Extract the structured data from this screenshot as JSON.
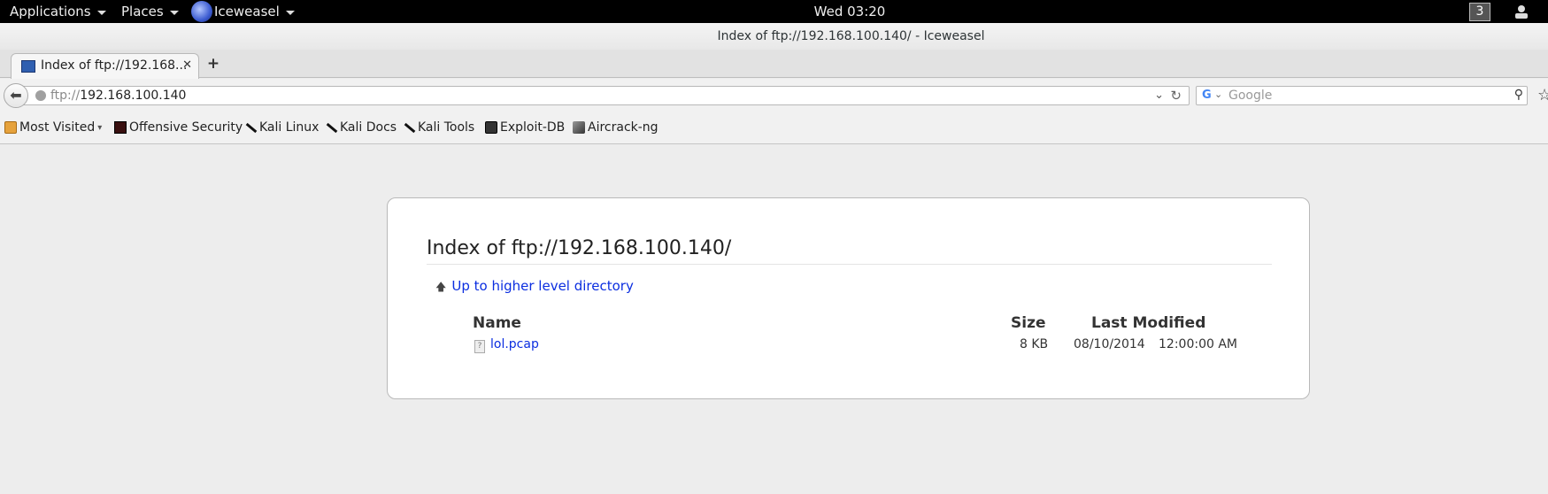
{
  "topbar": {
    "applications": "Applications",
    "places": "Places",
    "app_name": "Iceweasel",
    "clock": "Wed 03:20",
    "workspace": "3"
  },
  "window": {
    "title": "Index of ftp://192.168.100.140/ - Iceweasel"
  },
  "tabs": [
    {
      "label": "Index of ftp://192.168...",
      "active": true
    }
  ],
  "navbar": {
    "url_protocol": "ftp://",
    "url_host": "192.168.100.140",
    "search_placeholder": "Google"
  },
  "bookmarks": [
    {
      "label": "Most Visited",
      "icon": "folder-icon"
    },
    {
      "label": "Offensive Security",
      "icon": "offensive-security-icon"
    },
    {
      "label": "Kali Linux",
      "icon": "kali-dragon-icon"
    },
    {
      "label": "Kali Docs",
      "icon": "kali-dragon-icon"
    },
    {
      "label": "Kali Tools",
      "icon": "kali-dragon-icon"
    },
    {
      "label": "Exploit-DB",
      "icon": "exploit-db-icon"
    },
    {
      "label": "Aircrack-ng",
      "icon": "aircrack-icon"
    }
  ],
  "page": {
    "heading": "Index of ftp://192.168.100.140/",
    "up_link": "Up to higher level directory",
    "columns": {
      "name": "Name",
      "size": "Size",
      "modified": "Last Modified"
    },
    "files": [
      {
        "name": "lol.pcap",
        "size": "8 KB",
        "date": "08/10/2014",
        "time": "12:00:00 AM"
      }
    ]
  }
}
